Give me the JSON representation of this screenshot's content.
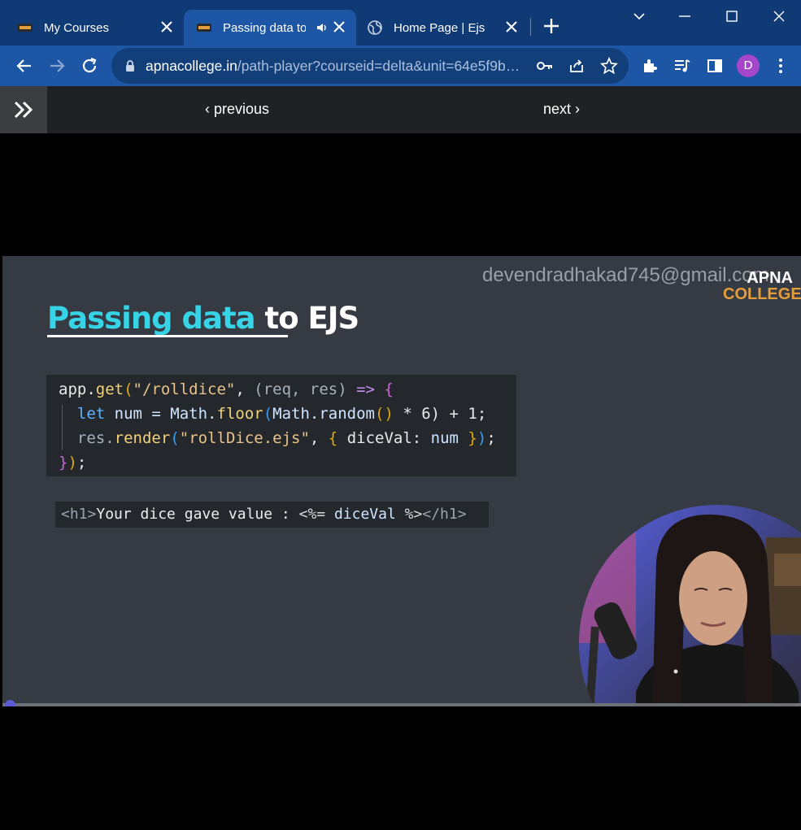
{
  "browser": {
    "tabs": [
      {
        "title": "My Courses",
        "favicon": "apna-college-favicon"
      },
      {
        "title": "Passing data to",
        "favicon": "apna-college-favicon",
        "active": true,
        "audio": true
      },
      {
        "title": "Home Page | Ejs",
        "favicon": "globe-icon"
      }
    ],
    "url_host": "apnacollege.in",
    "url_path": "/path-player?courseid=delta&unit=64e5f9b…",
    "profile_initial": "D",
    "colors": {
      "tabbar": "#0f3a75",
      "toolbar": "#1e56a6",
      "avatar": "#a646c9"
    }
  },
  "page_nav": {
    "previous_label": "previous",
    "next_label": "next"
  },
  "video": {
    "watermark": "devendradhakad745@gmail.com",
    "logo_line1": "APNA",
    "logo_line2": "COLLEGE",
    "title_highlight": "Passing data",
    "title_rest": " to EJS",
    "code": {
      "l1": {
        "a": "app.",
        "fn": "get",
        "p1": "(",
        "str": "\"/rolldice\"",
        "c1": ", ",
        "p2": "(req, res)",
        "arr": " => ",
        "b": "{"
      },
      "l2": {
        "kw": "let",
        "rest1": " num = ",
        "fn1": "Math.",
        "fn2": "floor",
        "p": "(",
        "fn3": "Math.random",
        "pp": "()",
        "rest2": " * 6) + 1;"
      },
      "l3": {
        "a": "res.",
        "fn": "render",
        "p": "(",
        "str": "\"rollDice.ejs\"",
        "c": ", ",
        "b": "{",
        "k": " diceVal: ",
        "v": "num",
        "e": " }",
        "pe": ")",
        "sc": ";"
      },
      "l4": {
        "b": "}",
        "p": ")",
        "sc": ";"
      }
    },
    "snippet": {
      "open_tag": "<h1>",
      "text": "Your dice gave value : ",
      "ejs_open": "<%=",
      "var": " diceVal ",
      "ejs_close": "%>",
      "close_tag": "</h1>"
    },
    "progress_fraction": 0.01
  }
}
